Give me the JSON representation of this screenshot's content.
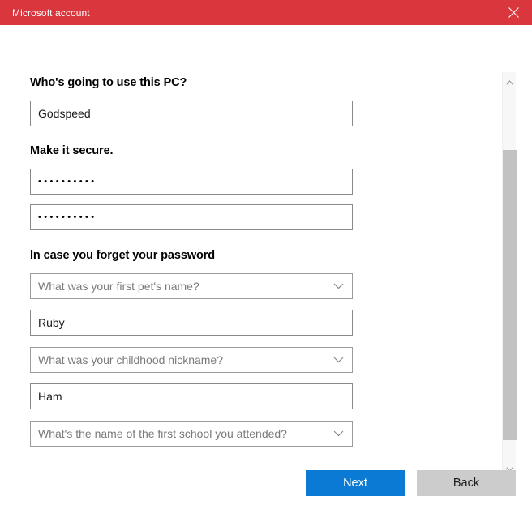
{
  "window": {
    "title": "Microsoft account",
    "titlebar_color": "#d9363e",
    "close_icon": "close-icon"
  },
  "form": {
    "sections": [
      {
        "heading": "Who's going to use this PC?",
        "username_value": "Godspeed"
      },
      {
        "heading": "Make it secure.",
        "password_value": "••••••••••",
        "password_confirm_value": "••••••••••"
      },
      {
        "heading": "In case you forget your password"
      }
    ],
    "heading_1": "Who's going to use this PC?",
    "heading_2": "Make it secure.",
    "heading_3": "In case you forget your password",
    "username_value": "Godspeed",
    "password_value": "••••••••••",
    "password_confirm_value": "••••••••••",
    "security": [
      {
        "question": "What was your first pet's name?",
        "answer": "Ruby"
      },
      {
        "question": "What was your childhood nickname?",
        "answer": "Ham"
      },
      {
        "question": "What's the name of the first school you attended?",
        "answer": ""
      }
    ]
  },
  "scrollbar": {
    "up_arrow_icon": "chevron-up-icon",
    "down_arrow_icon": "chevron-down-icon",
    "thumb_color": "#c2c2c2"
  },
  "footer": {
    "next_label": "Next",
    "back_label": "Back",
    "next_color": "#0a7ad4",
    "back_color": "#cccccc"
  }
}
